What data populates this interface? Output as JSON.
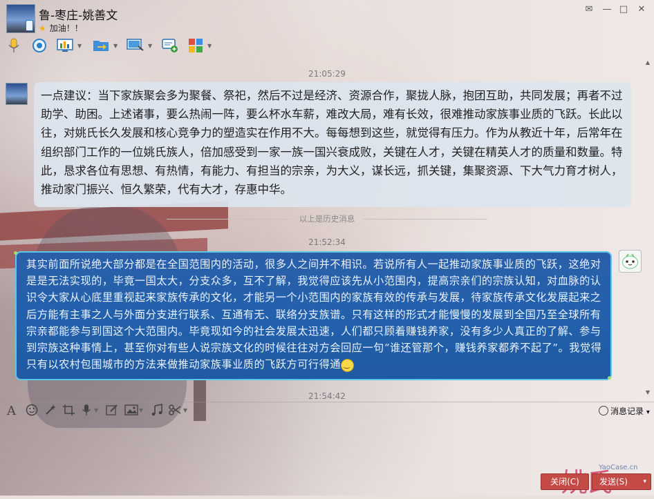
{
  "window": {
    "contact_name": "鲁-枣庄-姚善文",
    "signature": "加油！！",
    "controls": {
      "feedback": "✉",
      "minimize": "—",
      "maximize": "□",
      "close": "✕"
    }
  },
  "toolbar_icons": [
    "microphone-icon",
    "video-icon",
    "screen-share-icon",
    "file-transfer-icon",
    "remote-desktop-icon",
    "group-chat-icon",
    "apps-icon"
  ],
  "messages": [
    {
      "time": "21:05:29",
      "side": "left",
      "text": "一点建议：当下家族聚会多为聚餐、祭祀，然后不过是经济、资源合作，聚拢人脉，抱团互助，共同发展；再者不过助学、助困。上述诸事，要么热闹一阵，要么杯水车薪，难改大局，难有长效，很难推动家族事业质的飞跃。长此以往，对姚氏长久发展和核心竞争力的塑造实在作用不大。每每想到这些，就觉得有压力。作为从教近十年，后常年在组织部门工作的一位姚氏族人，倍加感受到一家一族一国兴衰成败，关键在人才，关键在精英人才的质量和数量。特此，恳求各位有思想、有热情，有能力、有担当的宗亲，为大义，谋长远，抓关键，集聚资源、下大气力育才树人，推动家门振兴、恒久繁荣，代有大才，存惠中华。"
    },
    {
      "time": "21:52:34",
      "side": "right",
      "text": "其实前面所说绝大部分都是在全国范围内的活动，很多人之间并不相识。若说所有人一起推动家族事业质的飞跃，这绝对是是无法实现的，毕竟一国太大，分支众多，互不了解，我觉得应该先从小范围内，提高宗亲们的宗族认知，对血脉的认识令大家从心底里重视起来家族传承的文化，才能另一个小范围内的家族有效的传承与发展，待家族传承文化发展起来之后方能有主事之人与外面分支进行联系、互通有无、联络分支族谱。只有这样的形式才能慢慢的发展到全国乃至全球所有宗亲都能参与到国这个大范围内。毕竟现如今的社会发展太迅速，人们都只顾着赚钱养家，没有多少人真正的了解、参与到宗族这种事情上，甚至你对有些人说宗族文化的时候往往对方会回应一句“谁还管那个，赚钱养家都养不起了”。我觉得只有以农村包围城市的方法来做推动家族事业质的飞跃方可行得通"
    }
  ],
  "history_separator": "以上是历史消息",
  "last_time": "21:54:42",
  "input_toolbar": {
    "font": "A",
    "history": "消息记录",
    "history_arrow": "▾"
  },
  "buttons": {
    "close": "关闭(C)",
    "send": "发送(S)",
    "send_arrow": "▾"
  },
  "watermark": {
    "text": "姚氏",
    "sub": "YaoCase.cn"
  }
}
